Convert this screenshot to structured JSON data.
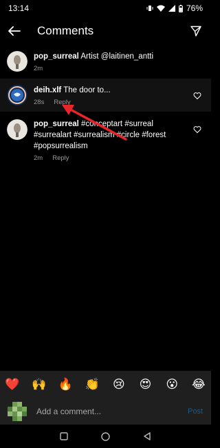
{
  "status": {
    "time": "13:14",
    "battery": "76%"
  },
  "header": {
    "title": "Comments"
  },
  "comments": [
    {
      "username": "pop_surreal",
      "text": "Artist @laitinen_antti",
      "time": "2m",
      "reply": ""
    },
    {
      "username": "deih.xlf",
      "text": "The door to...",
      "time": "28s",
      "reply": "Reply"
    },
    {
      "username": "pop_surreal",
      "text": "#conceptart #surreal #surrealart #surrealism #circle #forest #popsurrealism",
      "time": "2m",
      "reply": "Reply"
    }
  ],
  "emojis": [
    "❤️",
    "🙌",
    "🔥",
    "👏",
    "😢",
    "😍",
    "😮",
    "😂"
  ],
  "input": {
    "placeholder": "Add a comment...",
    "post_label": "Post"
  },
  "colors": {
    "background": "#000000",
    "bar": "#1f1f1f",
    "post": "#1f5a89",
    "annotation_arrow": "#e8262a"
  }
}
